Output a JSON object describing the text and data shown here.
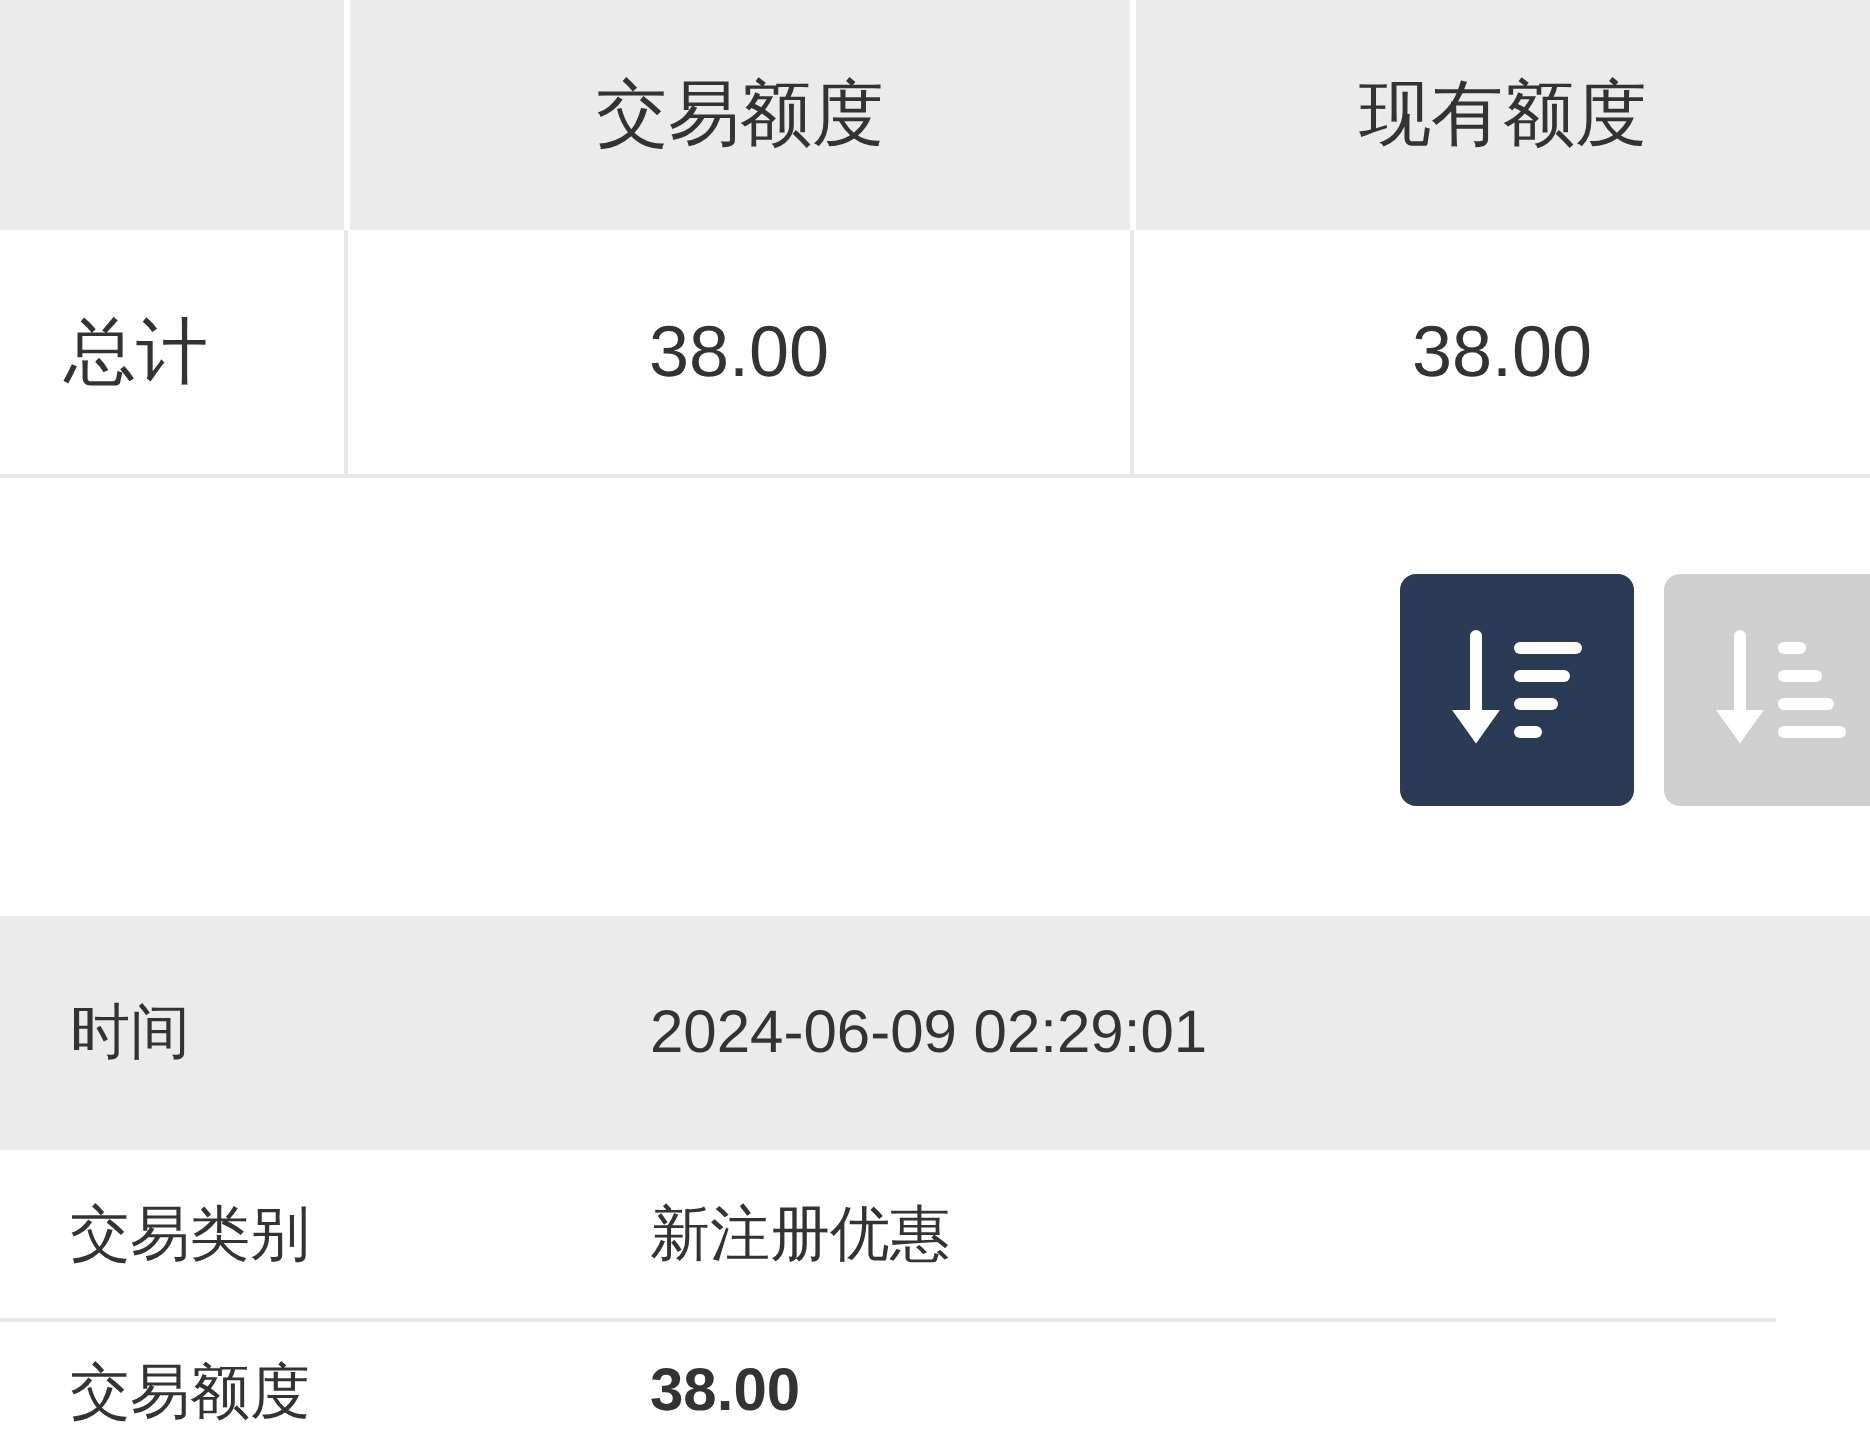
{
  "summary_table": {
    "columns": [
      "",
      "交易额度",
      "现有额度"
    ],
    "rows": [
      {
        "cells": [
          "总计",
          "38.00",
          "38.00"
        ]
      }
    ]
  },
  "sort_buttons": [
    {
      "kind": "descending",
      "selected": true
    },
    {
      "kind": "ascending",
      "selected": false
    }
  ],
  "record": [
    {
      "kind": "header",
      "label": "时间",
      "value": "2024-06-09 02:29:01"
    },
    {
      "kind": "plain",
      "label": "交易类别",
      "value": "新注册优惠"
    },
    {
      "kind": "amount",
      "label": "交易额度",
      "value": "38.00"
    }
  ]
}
